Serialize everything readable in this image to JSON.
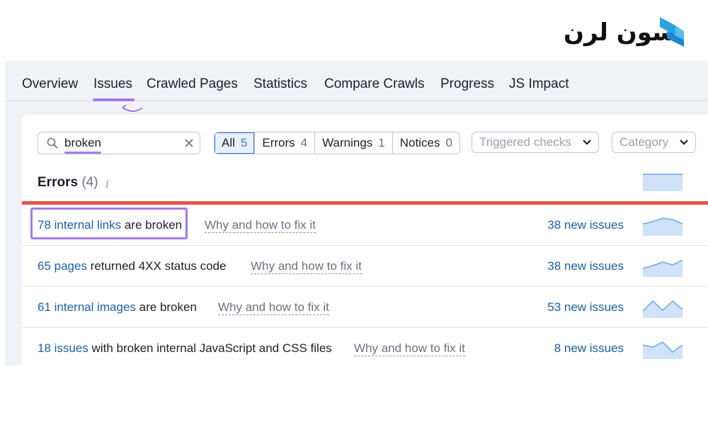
{
  "brand": {
    "logo_text": "سون لرن",
    "mark_color": "#2aa3e6"
  },
  "tabs": [
    {
      "label": "Overview"
    },
    {
      "label": "Issues",
      "active": true
    },
    {
      "label": "Crawled Pages"
    },
    {
      "label": "Statistics"
    },
    {
      "label": "Compare Crawls"
    },
    {
      "label": "Progress"
    },
    {
      "label": "JS Impact"
    }
  ],
  "search": {
    "value": "broken",
    "icon": "search-icon",
    "clear_icon": "close-icon"
  },
  "filters": [
    {
      "label": "All",
      "count": "5",
      "active": true
    },
    {
      "label": "Errors",
      "count": "4"
    },
    {
      "label": "Warnings",
      "count": "1"
    },
    {
      "label": "Notices",
      "count": "0"
    }
  ],
  "dropdowns": {
    "triggered_checks": "Triggered checks",
    "category": "Category"
  },
  "errors_section": {
    "title": "Errors",
    "count": "(4)",
    "info": "i"
  },
  "issues": [
    {
      "link": "78 internal links",
      "rest": " are broken",
      "why": "Why and how to fix it",
      "new_issues": "38 new issues",
      "trend": [
        0.55,
        0.7,
        0.95,
        0.85,
        0.55
      ]
    },
    {
      "link": "65 pages",
      "rest": " returned 4XX status code",
      "why": "Why and how to fix it",
      "new_issues": "38 new issues",
      "trend": [
        0.3,
        0.5,
        0.75,
        0.55,
        0.9
      ]
    },
    {
      "link": "61 internal images",
      "rest": " are broken",
      "why": "Why and how to fix it",
      "new_issues": "53 new issues",
      "trend": [
        0.2,
        0.9,
        0.25,
        0.9,
        0.3
      ]
    },
    {
      "link": "18 issues",
      "rest": " with broken internal JavaScript and CSS files",
      "why": "Why and how to fix it",
      "new_issues": "8 new issues",
      "trend": [
        0.7,
        0.55,
        0.9,
        0.2,
        0.7
      ]
    }
  ],
  "colors": {
    "accent_purple": "#a27bea",
    "link_blue": "#1a5fa8",
    "error_red": "#e2574c",
    "spark_fill": "#cfe2f8",
    "spark_line": "#6ea6e2"
  }
}
